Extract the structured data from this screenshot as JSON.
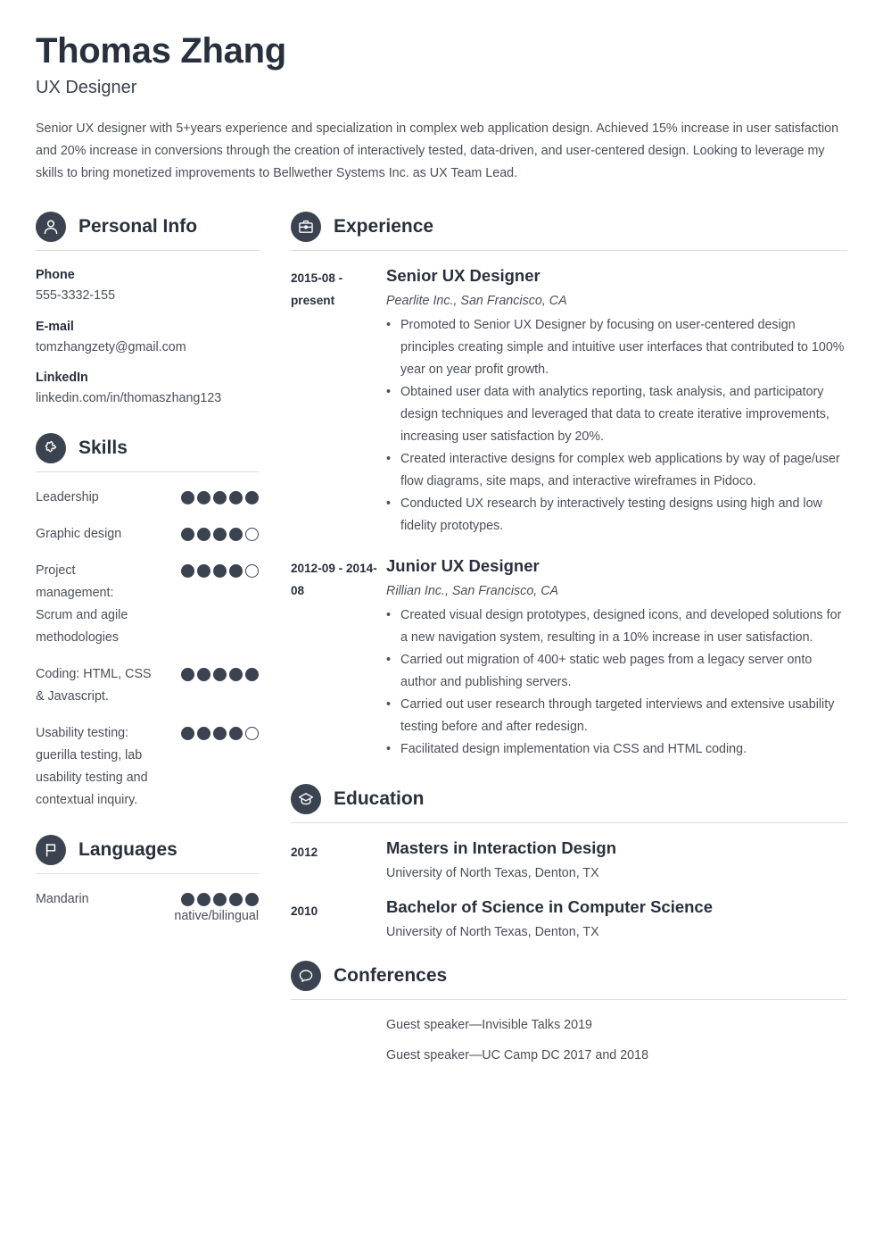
{
  "header": {
    "name": "Thomas Zhang",
    "job_title": "UX Designer",
    "summary": "Senior UX designer with 5+years experience and specialization in complex web application design. Achieved 15% increase in user satisfaction and 20% increase in conversions through the creation of interactively tested, data-driven, and user-centered design. Looking to leverage my skills to bring monetized improvements to Bellwether Systems Inc. as UX Team Lead."
  },
  "theme": {
    "accent": "#3b4250",
    "heading": "#29303d",
    "body_text": "#4a4f5a",
    "divider": "#dcdee2",
    "background": "#ffffff"
  },
  "personal_info": {
    "section_title": "Personal Info",
    "icon": "person-icon",
    "items": [
      {
        "label": "Phone",
        "value": "555-3332-155"
      },
      {
        "label": "E-mail",
        "value": "tomzhangzety@gmail.com"
      },
      {
        "label": "LinkedIn",
        "value": "linkedin.com/in/thomaszhang123"
      }
    ]
  },
  "skills": {
    "section_title": "Skills",
    "icon": "puzzle-piece-icon",
    "max_rating": 5,
    "items": [
      {
        "name": "Leadership",
        "rating": 5
      },
      {
        "name": "Graphic design",
        "rating": 4
      },
      {
        "name": "Project management: Scrum and agile methodologies",
        "rating": 4
      },
      {
        "name": "Coding: HTML, CSS & Javascript.",
        "rating": 5
      },
      {
        "name": "Usability testing: guerilla testing, lab usability testing and contextual inquiry.",
        "rating": 4
      }
    ]
  },
  "languages": {
    "section_title": "Languages",
    "icon": "flag-icon",
    "max_rating": 5,
    "items": [
      {
        "name": "Mandarin",
        "rating": 5,
        "note": "native/bilingual"
      }
    ]
  },
  "experience": {
    "section_title": "Experience",
    "icon": "briefcase-icon",
    "jobs": [
      {
        "date": "2015-08 - present",
        "title": "Senior UX Designer",
        "company": "Pearlite Inc., San Francisco, CA",
        "bullets": [
          "Promoted to Senior UX Designer by focusing on user-centered design principles creating simple and intuitive user interfaces that contributed to 100% year on year profit growth.",
          "Obtained user data with analytics reporting, task analysis, and participatory design techniques and leveraged that data to create iterative improvements, increasing user satisfaction by 20%.",
          "Created interactive designs for complex web applications by way of page/user flow diagrams, site maps, and interactive wireframes in Pidoco.",
          "Conducted UX research by interactively testing designs using high and low fidelity prototypes."
        ]
      },
      {
        "date": "2012-09 - 2014-08",
        "title": "Junior UX Designer",
        "company": "Rillian Inc., San Francisco, CA",
        "bullets": [
          "Created visual design prototypes, designed icons, and developed solutions for a new navigation system, resulting in a 10% increase in user satisfaction.",
          "Carried out migration of 400+ static web pages from a legacy server onto author and publishing servers.",
          "Carried out user research through targeted interviews and extensive usability testing before and after redesign.",
          "Facilitated design implementation via CSS and HTML coding."
        ]
      }
    ]
  },
  "education": {
    "section_title": "Education",
    "icon": "graduation-cap-icon",
    "entries": [
      {
        "date": "2012",
        "degree": "Masters in Interaction Design",
        "school": "University of North Texas, Denton, TX"
      },
      {
        "date": "2010",
        "degree": "Bachelor of Science in Computer Science",
        "school": "University of North Texas, Denton, TX"
      }
    ]
  },
  "conferences": {
    "section_title": "Conferences",
    "icon": "speech-bubble-icon",
    "items": [
      "Guest speaker—Invisible Talks 2019",
      "Guest speaker—UC Camp DC 2017 and 2018"
    ]
  }
}
